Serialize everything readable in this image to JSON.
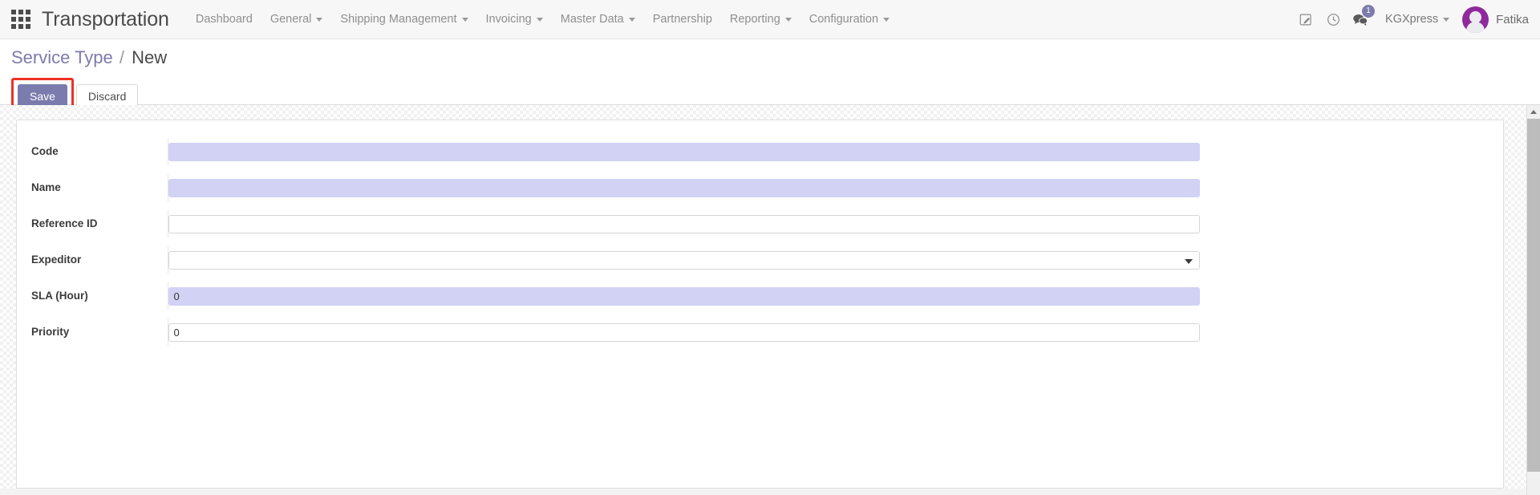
{
  "navbar": {
    "apps_icon": "apps-grid-icon",
    "brand": "Transportation",
    "menus": [
      {
        "label": "Dashboard",
        "has_caret": false
      },
      {
        "label": "General",
        "has_caret": true
      },
      {
        "label": "Shipping Management",
        "has_caret": true
      },
      {
        "label": "Invoicing",
        "has_caret": true
      },
      {
        "label": "Master Data",
        "has_caret": true
      },
      {
        "label": "Partnership",
        "has_caret": false
      },
      {
        "label": "Reporting",
        "has_caret": true
      },
      {
        "label": "Configuration",
        "has_caret": true
      }
    ],
    "right": {
      "edit_icon": "edit-pencil-icon",
      "activity_icon": "clock-icon",
      "messages_icon": "chat-bubbles-icon",
      "messages_badge": "1",
      "company": "KGXpress",
      "avatar_icon": "user-avatar-icon",
      "user_name": "Fatika"
    }
  },
  "control_panel": {
    "breadcrumb_parent": "Service Type",
    "breadcrumb_separator": "/",
    "breadcrumb_current": "New",
    "save_label": "Save",
    "discard_label": "Discard",
    "highlight_color": "#ee3124"
  },
  "form": {
    "fields": [
      {
        "label": "Code",
        "value": "",
        "placeholder": "",
        "type": "text",
        "required": true
      },
      {
        "label": "Name",
        "value": "",
        "placeholder": "",
        "type": "text",
        "required": true
      },
      {
        "label": "Reference ID",
        "value": "",
        "placeholder": "",
        "type": "text",
        "required": false
      },
      {
        "label": "Expeditor",
        "value": "",
        "placeholder": "",
        "type": "select",
        "required": false
      },
      {
        "label": "SLA (Hour)",
        "value": "0",
        "placeholder": "",
        "type": "text",
        "required": true
      },
      {
        "label": "Priority",
        "value": "0",
        "placeholder": "",
        "type": "text",
        "required": false
      }
    ]
  },
  "scrollbar": {
    "up_arrow_icon": "chevron-up-icon"
  },
  "colors": {
    "accent": "#7c7bad",
    "required_field": "#d2d2f5",
    "avatar": "#8e2a9c",
    "highlight": "#ee3124"
  }
}
